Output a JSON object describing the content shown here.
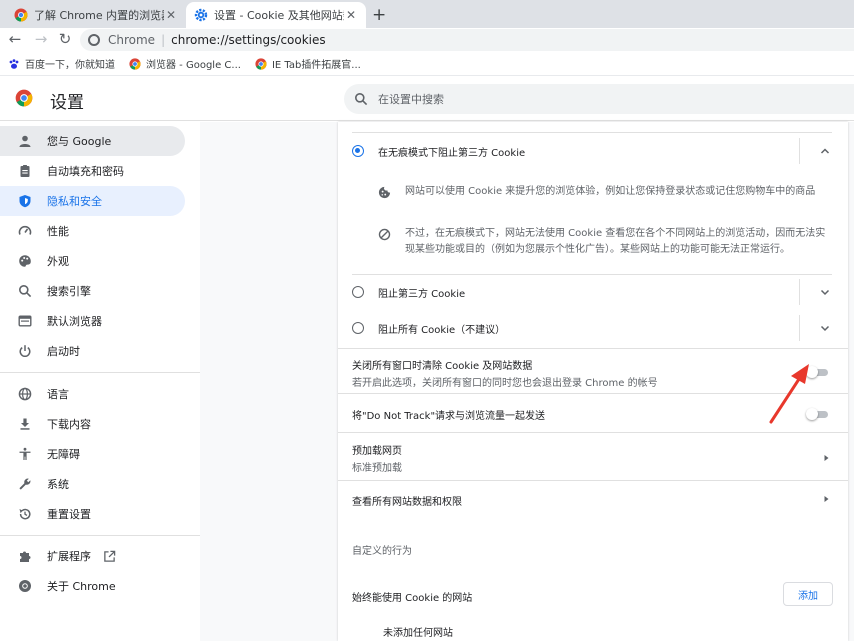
{
  "tabs": [
    {
      "title": "了解 Chrome 内置的浏览器工具",
      "close": "✕"
    },
    {
      "title": "设置 - Cookie 及其他网站数据",
      "close": "✕"
    }
  ],
  "new_tab": "+",
  "toolbar": {
    "back": "←",
    "forward": "→",
    "reload": "↻"
  },
  "omnibox": {
    "prefix": "Chrome",
    "separator": "|",
    "url": "chrome://settings/cookies"
  },
  "bookmarks": [
    {
      "label": "百度一下，你就知道",
      "icon": "paw-icon"
    },
    {
      "label": "浏览器 - Google C...",
      "icon": "chrome-icon"
    },
    {
      "label": "IE Tab插件拓展官...",
      "icon": "chrome-icon"
    }
  ],
  "header": {
    "title": "设置",
    "search_placeholder": "在设置中搜索"
  },
  "sidebar": {
    "items": [
      {
        "label": "您与 Google",
        "icon": "person-icon"
      },
      {
        "label": "自动填充和密码",
        "icon": "clipboard-icon"
      },
      {
        "label": "隐私和安全",
        "icon": "shield-icon"
      },
      {
        "label": "性能",
        "icon": "speedometer-icon"
      },
      {
        "label": "外观",
        "icon": "palette-icon"
      },
      {
        "label": "搜索引擎",
        "icon": "search-icon"
      },
      {
        "label": "默认浏览器",
        "icon": "browser-icon"
      },
      {
        "label": "启动时",
        "icon": "power-icon"
      },
      {
        "label": "语言",
        "icon": "globe-icon"
      },
      {
        "label": "下载内容",
        "icon": "download-icon"
      },
      {
        "label": "无障碍",
        "icon": "accessibility-icon"
      },
      {
        "label": "系统",
        "icon": "wrench-icon"
      },
      {
        "label": "重置设置",
        "icon": "reset-icon"
      },
      {
        "label": "扩展程序",
        "icon": "puzzle-icon"
      },
      {
        "label": "关于 Chrome",
        "icon": "chrome-icon"
      }
    ]
  },
  "cookies": {
    "option_incognito": "在无痕模式下阻止第三方 Cookie",
    "desc_1": "网站可以使用 Cookie 来提升您的浏览体验，例如让您保持登录状态或记住您购物车中的商品",
    "desc_2": "不过，在无痕模式下，网站无法使用 Cookie 查看您在各个不同网站上的浏览活动，因而无法实现某些功能或目的（例如为您展示个性化广告）。某些网站上的功能可能无法正常运行。",
    "option_block_third": "阻止第三方 Cookie",
    "option_block_all": "阻止所有 Cookie（不建议）",
    "clear_on_exit_title": "关闭所有窗口时清除 Cookie 及网站数据",
    "clear_on_exit_sub": "若开启此选项，关闭所有窗口的同时您也会退出登录 Chrome 的帐号",
    "clear_on_exit_enabled": false,
    "dnt_title": "将\"Do Not Track\"请求与浏览流量一起发送",
    "dnt_enabled": false,
    "preload_title": "预加载网页",
    "preload_sub": "标准预加载",
    "all_site_data": "查看所有网站数据和权限",
    "custom_behavior": "自定义的行为",
    "always_allow": "始终能使用 Cookie 的网站",
    "add_button": "添加",
    "no_sites": "未添加任何网站"
  },
  "colors": {
    "accent": "#1a73e8",
    "annotation_arrow": "#e8382c"
  }
}
